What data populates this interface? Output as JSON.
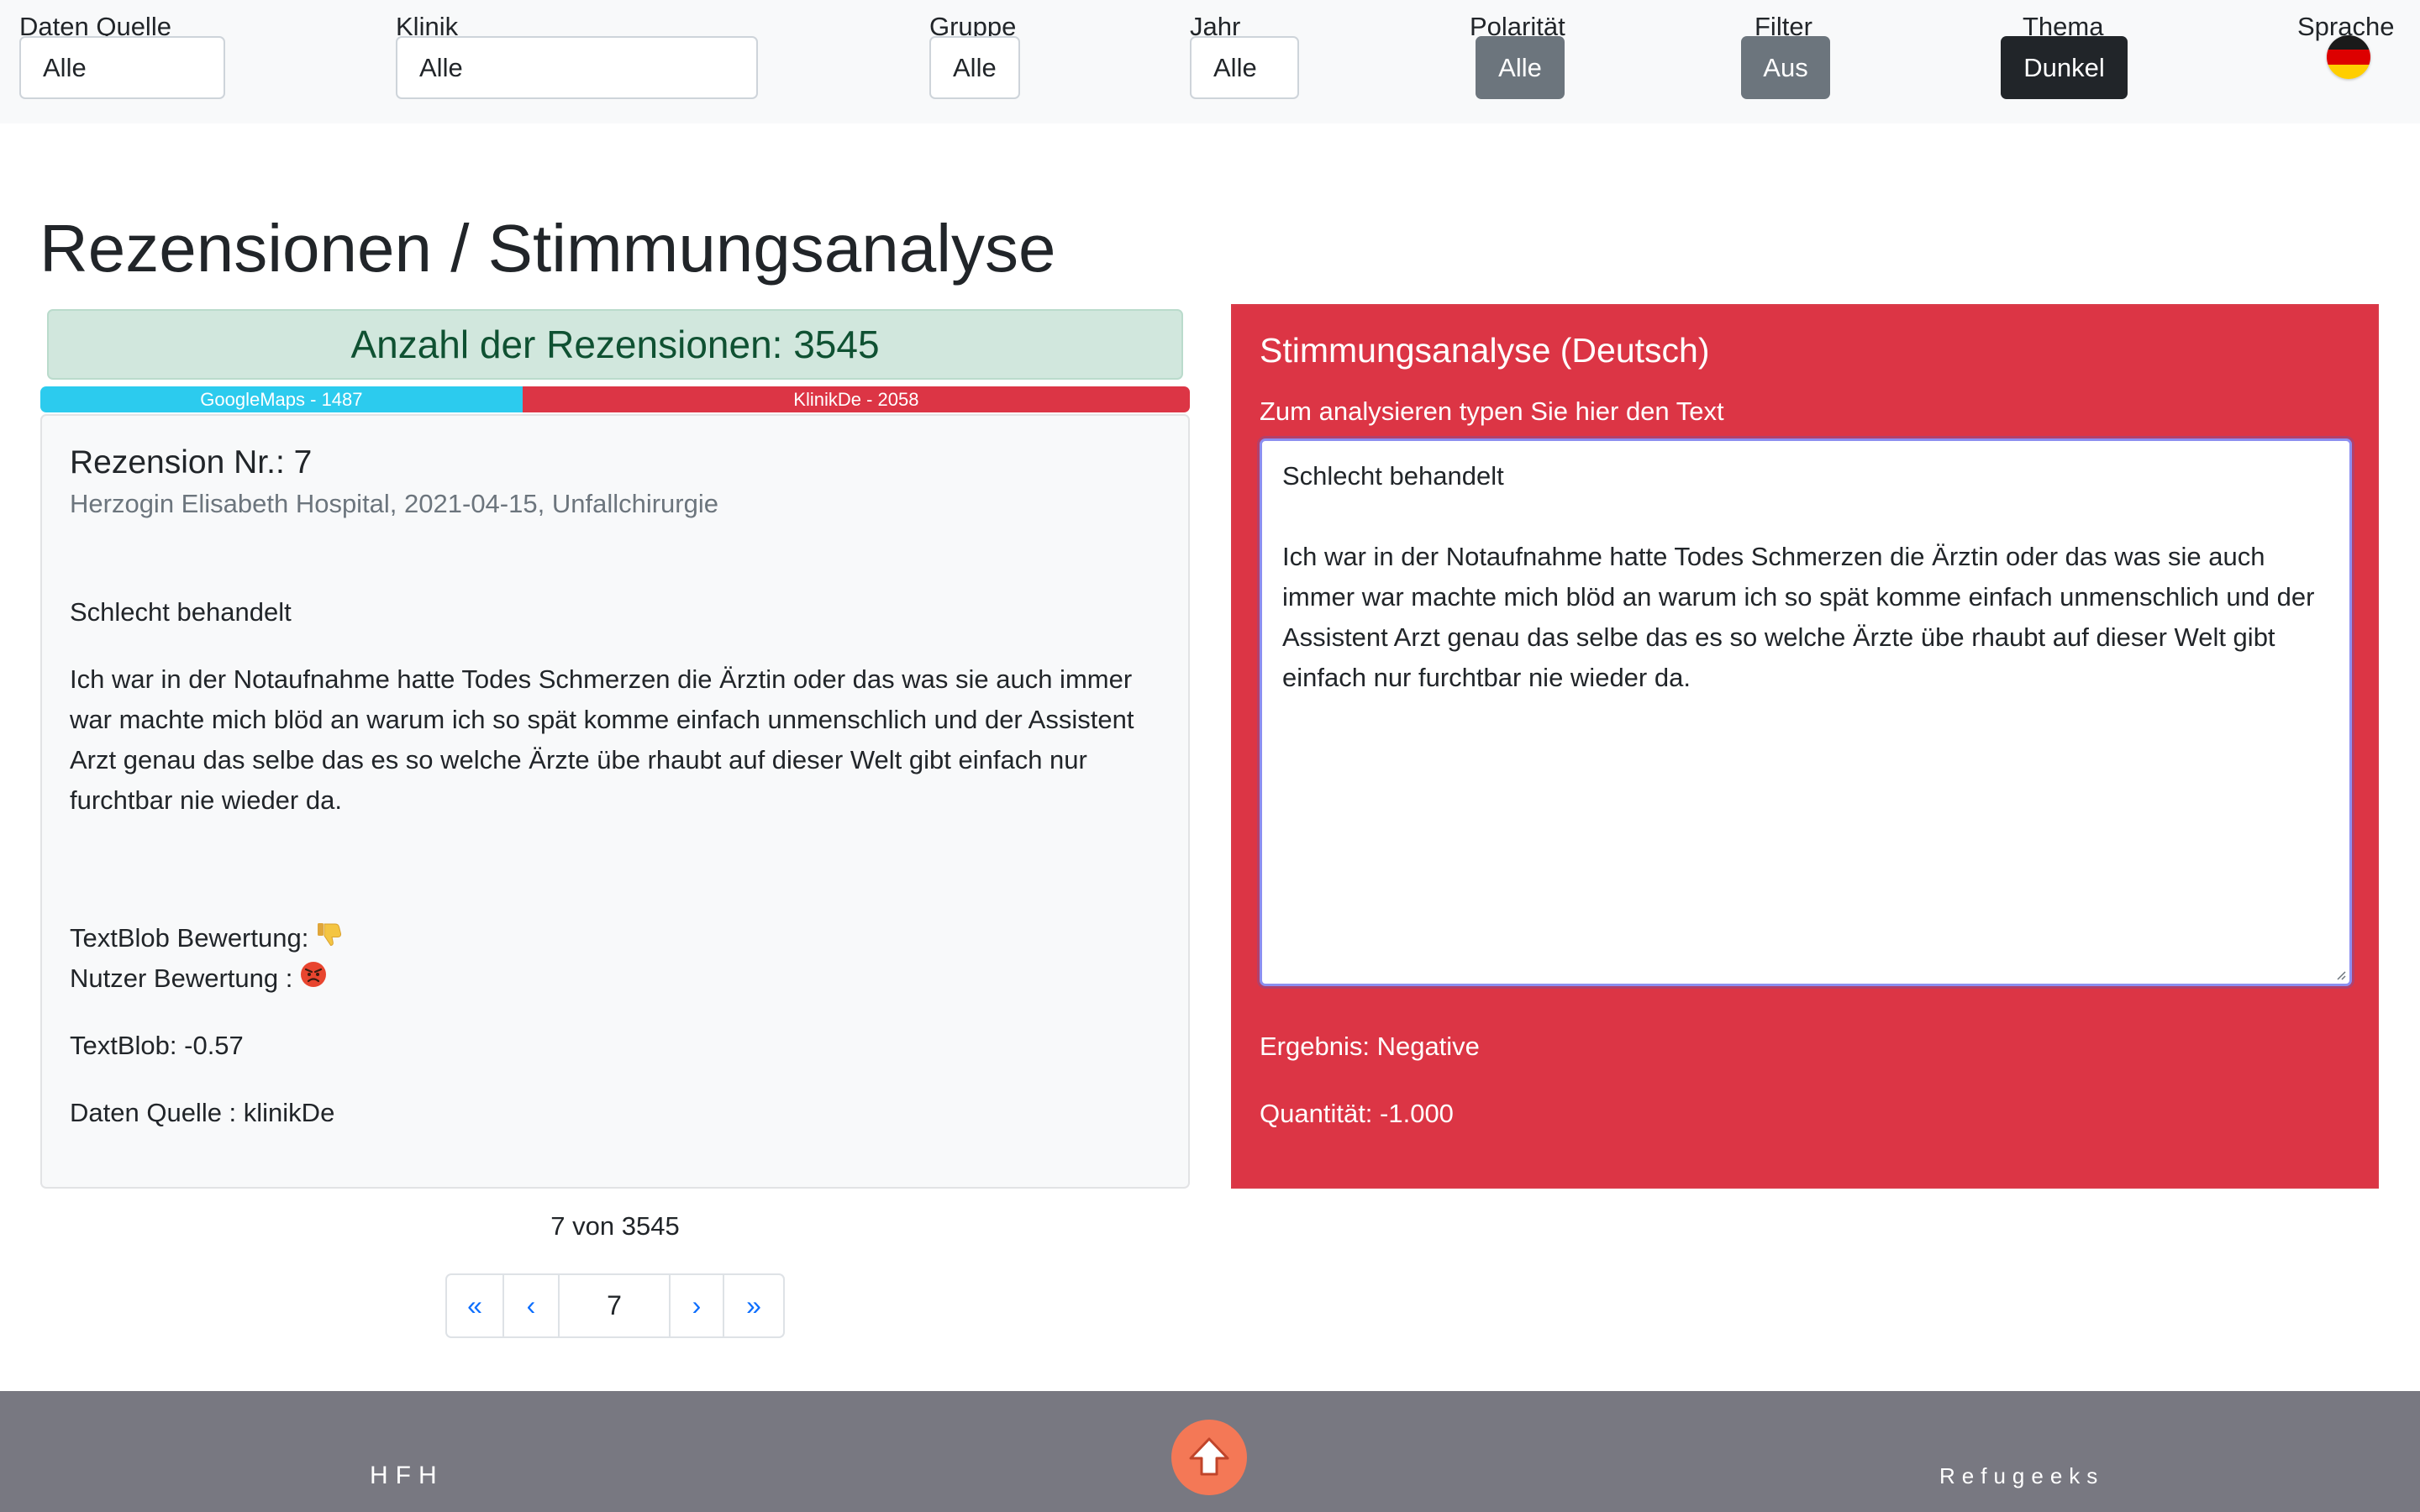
{
  "filters": {
    "source": {
      "label": "Daten Quelle",
      "value": "Alle"
    },
    "clinic": {
      "label": "Klinik",
      "value": "Alle"
    },
    "group": {
      "label": "Gruppe",
      "value": "Alle"
    },
    "year": {
      "label": "Jahr",
      "value": "Alle"
    },
    "polarity": {
      "label": "Polarität",
      "value": "Alle"
    },
    "filter": {
      "label": "Filter",
      "value": "Aus"
    },
    "theme": {
      "label": "Thema",
      "value": "Dunkel"
    },
    "language": {
      "label": "Sprache",
      "icon": "german-flag-icon"
    }
  },
  "page": {
    "title": "Rezensionen / Stimmungsanalyse"
  },
  "summary": {
    "count_label": "Anzahl der Rezensionen: 3545",
    "google_label": "GoogleMaps - 1487",
    "google_count": 1487,
    "klinik_label": "KlinikDe - 2058",
    "klinik_count": 2058
  },
  "review": {
    "title": "Rezension Nr.: 7",
    "subtitle": "Herzogin Elisabeth Hospital, 2021-04-15, Unfallchirurgie",
    "heading": "Schlecht behandelt",
    "body": "Ich war in der Notaufnahme hatte Todes Schmerzen die Ärztin oder das was sie auch immer war machte mich blöd an warum ich so spät komme einfach unmenschlich und der Assistent Arzt genau das selbe das es so welche Ärzte übe rhaubt auf dieser Welt gibt einfach nur furchtbar nie wieder da.",
    "textblob_rating_label": "TextBlob Bewertung:",
    "textblob_rating_icon": "thumbs-down-icon",
    "user_rating_label": "Nutzer Bewertung :",
    "user_rating_icon": "angry-face-icon",
    "textblob_score": "TextBlob: -0.57",
    "source": "Daten Quelle : klinikDe"
  },
  "pagination": {
    "info": "7 von 3545",
    "first": "«",
    "prev": "‹",
    "current": "7",
    "next": "›",
    "last": "»"
  },
  "sentiment": {
    "title": "Stimmungsanalyse (Deutsch)",
    "input_label": "Zum analysieren typen Sie hier den Text",
    "input_heading": "Schlecht behandelt",
    "input_body": "Ich war in der Notaufnahme hatte Todes Schmerzen die Ärztin oder das was sie auch immer war machte mich blöd an warum ich so spät komme einfach unmenschlich und der Assistent Arzt genau das selbe das es so welche Ärzte übe rhaubt auf dieser Welt gibt einfach nur furchtbar nie wieder da.",
    "result": "Ergebnis: Negative",
    "quantity": "Quantität: -1.000"
  },
  "footer": {
    "left": "HFH",
    "right": "Refugeeks",
    "scroll_icon": "arrow-up-icon"
  },
  "colors": {
    "panel": "#dc3545",
    "google": "#2ccbee",
    "klinik": "#dc3545",
    "footer": "#787881",
    "scroll_button": "#f47856"
  }
}
